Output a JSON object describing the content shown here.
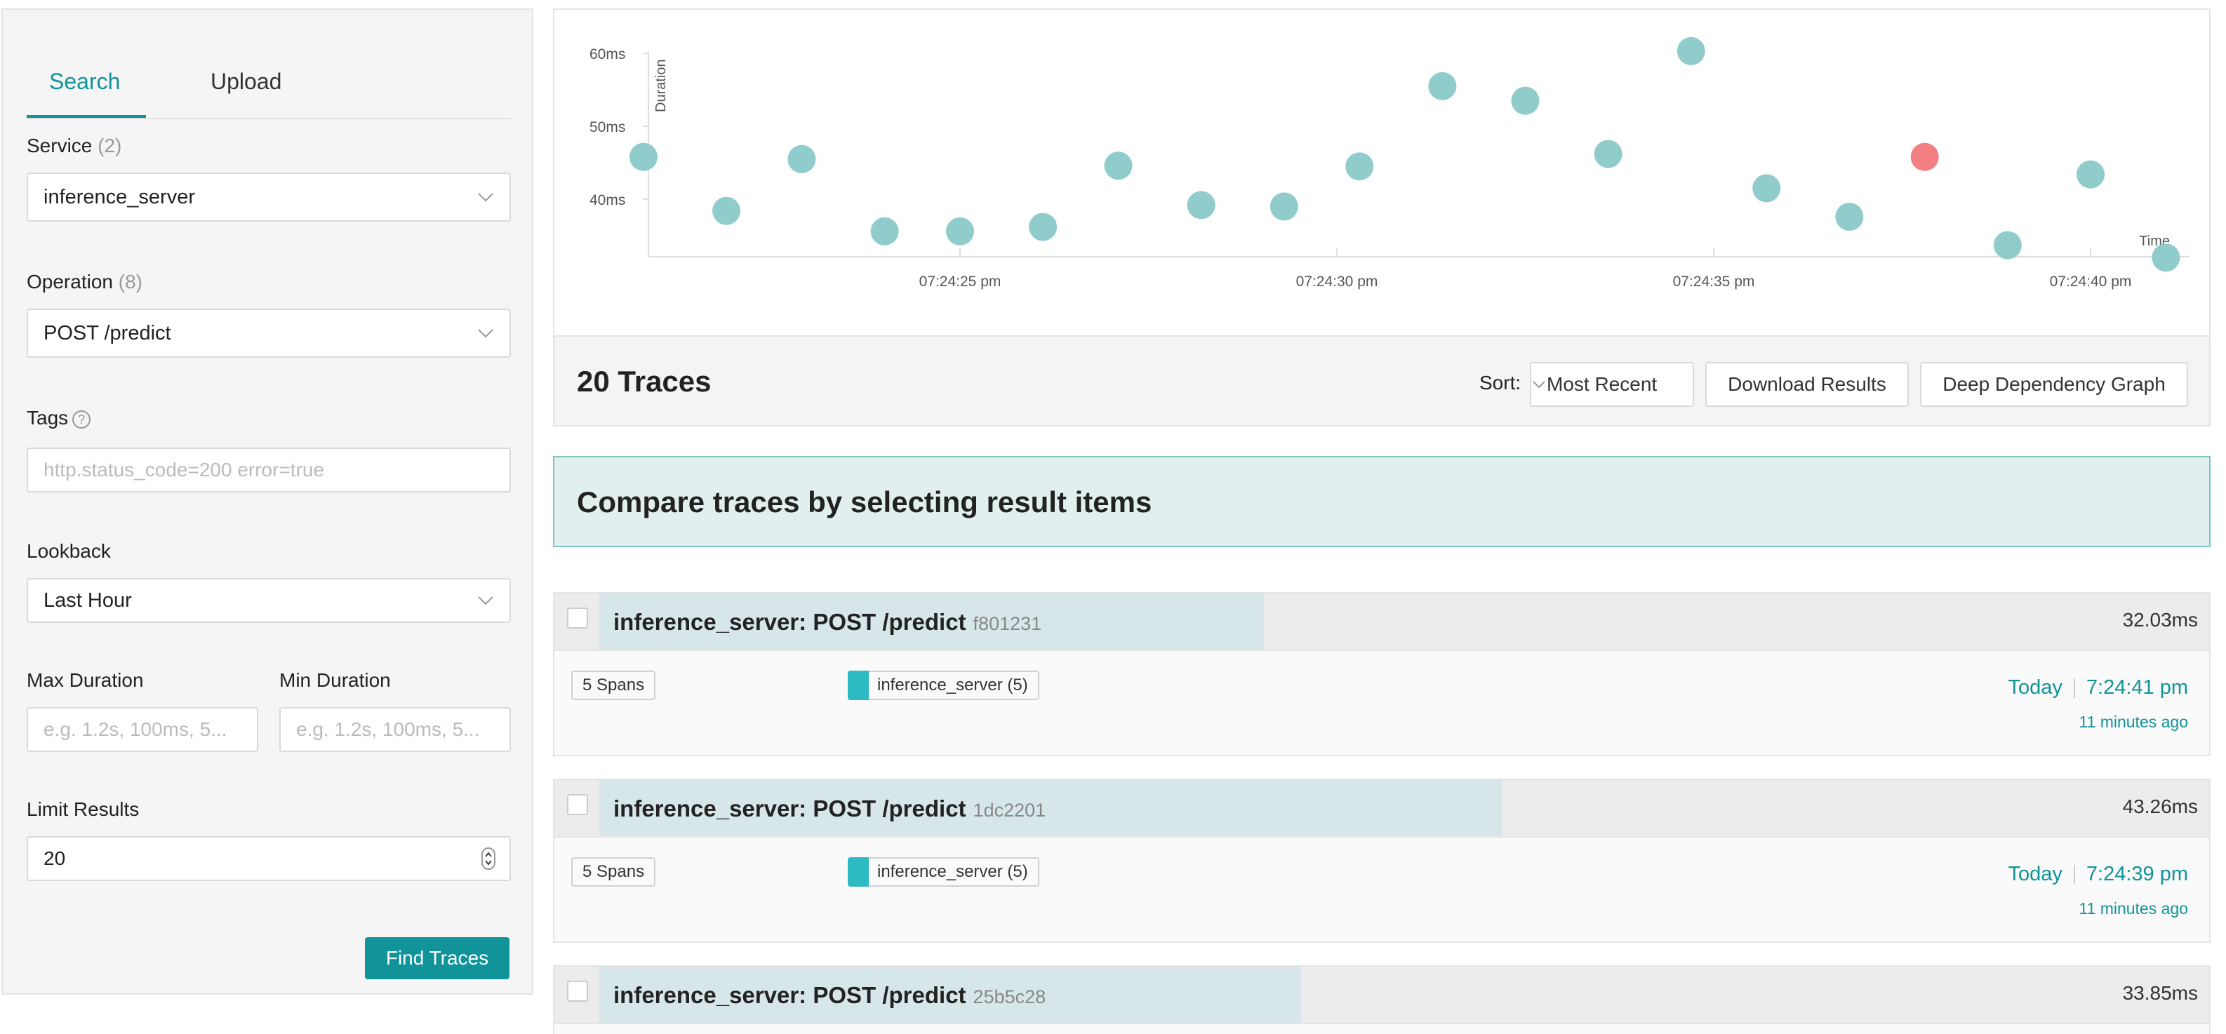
{
  "sidebar": {
    "tabs": [
      {
        "label": "Search"
      },
      {
        "label": "Upload"
      }
    ],
    "service": {
      "label": "Service",
      "count": "(2)",
      "value": "inference_server"
    },
    "operation": {
      "label": "Operation",
      "count": "(8)",
      "value": "POST /predict"
    },
    "tags": {
      "label": "Tags",
      "help": "?",
      "placeholder": "http.status_code=200 error=true"
    },
    "lookback": {
      "label": "Lookback",
      "value": "Last Hour"
    },
    "max_duration": {
      "label": "Max Duration",
      "placeholder": "e.g. 1.2s, 100ms, 5..."
    },
    "min_duration": {
      "label": "Min Duration",
      "placeholder": "e.g. 1.2s, 100ms, 5..."
    },
    "limit": {
      "label": "Limit Results",
      "value": "20"
    },
    "find_button": "Find Traces"
  },
  "chart_data": {
    "type": "scatter",
    "ylabel": "Duration",
    "xlabel": "Time",
    "y_ticks": [
      "40ms",
      "50ms",
      "60ms"
    ],
    "x_ticks": [
      "07:24:25 pm",
      "07:24:30 pm",
      "07:24:35 pm",
      "07:24:40 pm"
    ],
    "points": [
      {
        "t": 20.8,
        "ms": 45.8,
        "error": false
      },
      {
        "t": 21.9,
        "ms": 38.4,
        "error": false
      },
      {
        "t": 22.9,
        "ms": 45.5,
        "error": false
      },
      {
        "t": 24.0,
        "ms": 35.6,
        "error": false
      },
      {
        "t": 25.0,
        "ms": 35.6,
        "error": false
      },
      {
        "t": 26.1,
        "ms": 36.2,
        "error": false
      },
      {
        "t": 27.1,
        "ms": 44.6,
        "error": false
      },
      {
        "t": 28.2,
        "ms": 39.2,
        "error": false
      },
      {
        "t": 29.3,
        "ms": 39.0,
        "error": false
      },
      {
        "t": 30.3,
        "ms": 44.5,
        "error": false
      },
      {
        "t": 31.4,
        "ms": 55.5,
        "error": false
      },
      {
        "t": 32.5,
        "ms": 53.5,
        "error": false
      },
      {
        "t": 33.6,
        "ms": 46.2,
        "error": false
      },
      {
        "t": 34.7,
        "ms": 60.3,
        "error": false
      },
      {
        "t": 35.7,
        "ms": 41.5,
        "error": false
      },
      {
        "t": 36.8,
        "ms": 37.6,
        "error": false
      },
      {
        "t": 37.8,
        "ms": 45.8,
        "error": true
      },
      {
        "t": 38.9,
        "ms": 33.7,
        "error": false
      },
      {
        "t": 40.0,
        "ms": 43.4,
        "error": false
      },
      {
        "t": 41.0,
        "ms": 32.0,
        "error": false
      }
    ],
    "colors": {
      "ok": "#8fcccb",
      "error": "#f27f84"
    }
  },
  "results": {
    "title": "20 Traces",
    "sort_label": "Sort:",
    "sort_value": "Most Recent",
    "download_button": "Download Results",
    "ddg_button": "Deep Dependency Graph"
  },
  "compare_banner": "Compare traces by selecting result items",
  "traces": [
    {
      "title": "inference_server: POST /predict",
      "id": "f801231",
      "duration": "32.03ms",
      "duration_fraction": 0.53,
      "spans": "5 Spans",
      "service": "inference_server (5)",
      "date": "Today",
      "time": "7:24:41 pm",
      "ago": "11 minutes ago"
    },
    {
      "title": "inference_server: POST /predict",
      "id": "1dc2201",
      "duration": "43.26ms",
      "duration_fraction": 0.72,
      "spans": "5 Spans",
      "service": "inference_server (5)",
      "date": "Today",
      "time": "7:24:39 pm",
      "ago": "11 minutes ago"
    },
    {
      "title": "inference_server: POST /predict",
      "id": "25b5c28",
      "duration": "33.85ms",
      "duration_fraction": 0.56
    }
  ]
}
